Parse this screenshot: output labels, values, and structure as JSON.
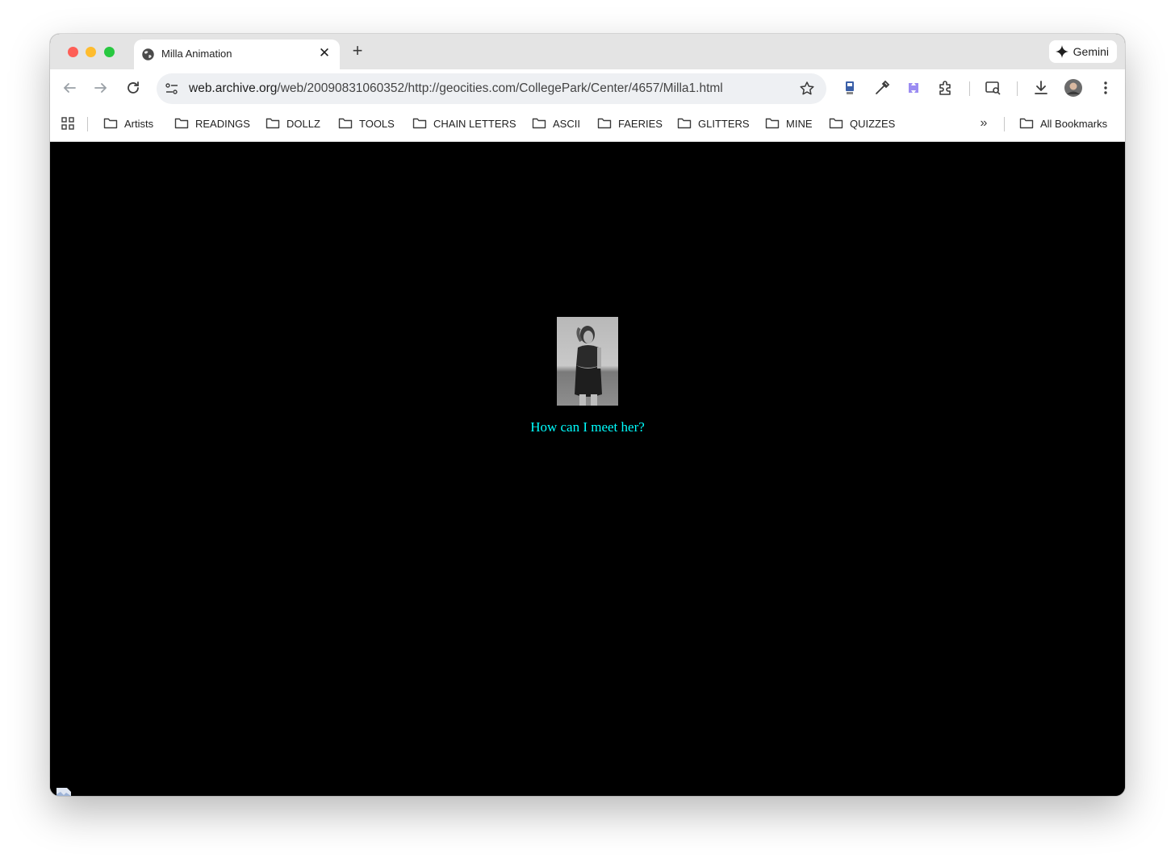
{
  "browser": {
    "tab": {
      "title": "Milla Animation",
      "favicon": "globe-icon"
    },
    "gemini_label": "Gemini",
    "address": {
      "url_host": "web.archive.org",
      "url_path": "/web/20090831060352/http://geocities.com/CollegePark/Center/4657/Milla1.html"
    },
    "bookmarks": [
      {
        "label": "Artists"
      },
      {
        "label": "READINGS"
      },
      {
        "label": "DOLLZ"
      },
      {
        "label": "TOOLS"
      },
      {
        "label": "CHAIN LETTERS"
      },
      {
        "label": "ASCII"
      },
      {
        "label": "FAERIES"
      },
      {
        "label": "GLITTERS"
      },
      {
        "label": "MINE"
      },
      {
        "label": "QUIZZES"
      }
    ],
    "all_bookmarks_label": "All Bookmarks"
  },
  "page": {
    "background": "#000000",
    "link_color": "#00ffff",
    "caption": "How can I meet her?"
  }
}
